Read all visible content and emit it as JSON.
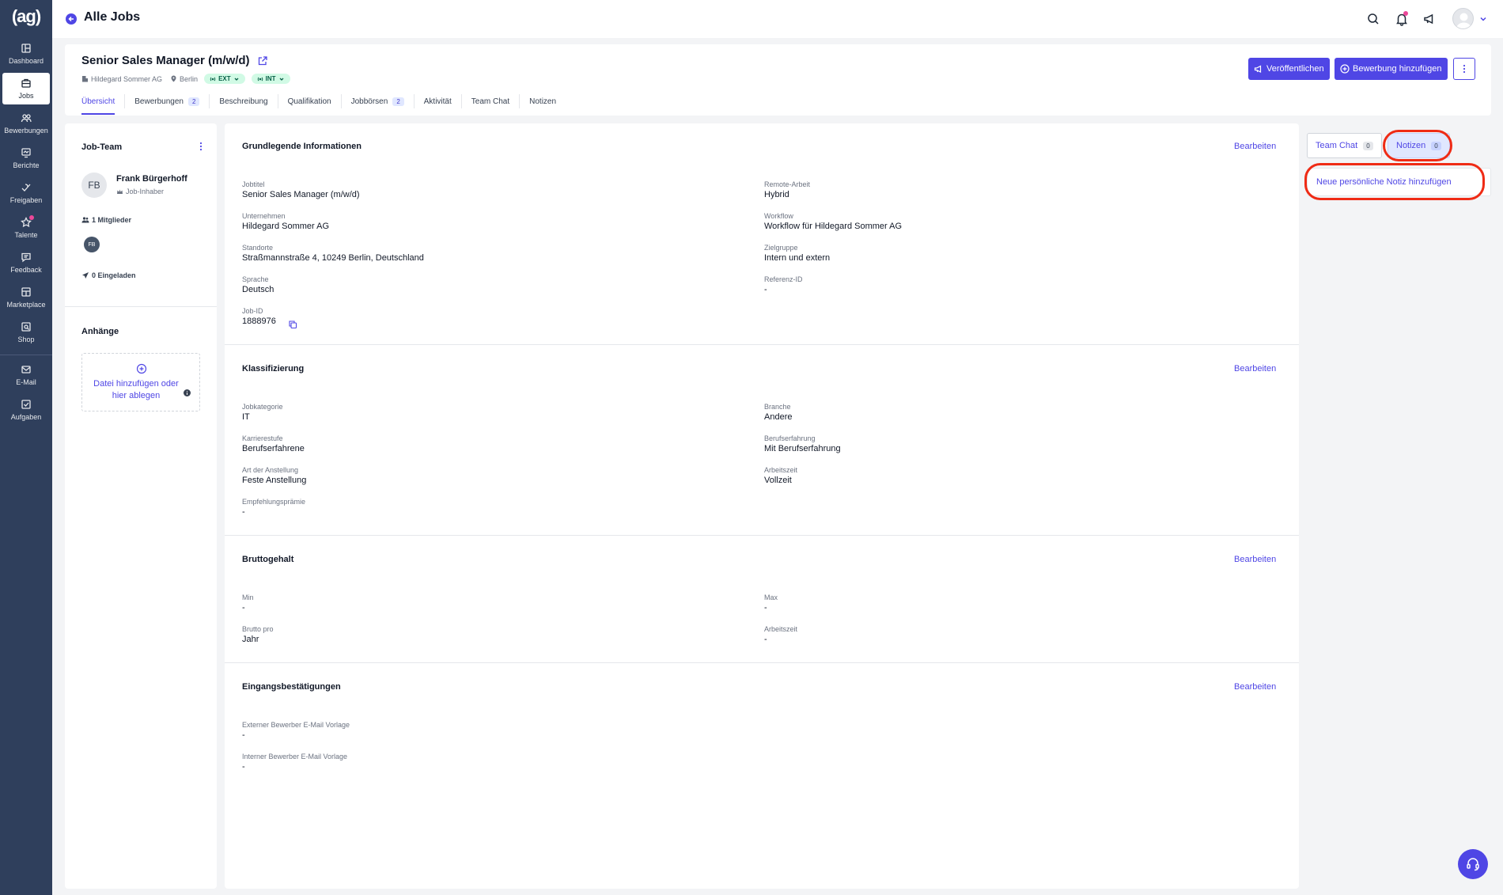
{
  "sidebar": {
    "logo": "(ag)",
    "items": [
      {
        "label": "Dashboard",
        "icon": "dashboard-icon"
      },
      {
        "label": "Jobs",
        "icon": "briefcase-icon",
        "active": true
      },
      {
        "label": "Bewerbungen",
        "icon": "users-icon"
      },
      {
        "label": "Berichte",
        "icon": "chart-icon"
      },
      {
        "label": "Freigaben",
        "icon": "approval-icon"
      },
      {
        "label": "Talente",
        "icon": "star-icon"
      },
      {
        "label": "Feedback",
        "icon": "chat-icon"
      },
      {
        "label": "Marketplace",
        "icon": "grid-icon"
      },
      {
        "label": "Shop",
        "icon": "shop-icon"
      },
      {
        "label": "E-Mail",
        "icon": "mail-icon"
      },
      {
        "label": "Aufgaben",
        "icon": "task-icon"
      }
    ]
  },
  "topbar": {
    "title": "Alle Jobs"
  },
  "job": {
    "title": "Senior Sales Manager (m/w/d)",
    "company": "Hildegard Sommer AG",
    "city": "Berlin",
    "pill_ext": "EXT",
    "pill_int": "INT",
    "publish_label": "Veröffentlichen",
    "add_application_label": "Bewerbung hinzufügen",
    "tabs": [
      {
        "label": "Übersicht",
        "active": true
      },
      {
        "label": "Bewerbungen",
        "badge": "2"
      },
      {
        "label": "Beschreibung"
      },
      {
        "label": "Qualifikation"
      },
      {
        "label": "Jobbörsen",
        "badge": "2"
      },
      {
        "label": "Aktivität"
      },
      {
        "label": "Team Chat"
      },
      {
        "label": "Notizen"
      }
    ]
  },
  "team": {
    "title": "Job-Team",
    "member_initials": "FB",
    "member_name": "Frank Bürgerhoff",
    "member_role": "Job-Inhaber",
    "members_count": "1 Mitglieder",
    "invited": "0 Eingeladen"
  },
  "attachments": {
    "title": "Anhänge",
    "drop_line1": "Datei hinzufügen oder",
    "drop_line2": "hier ablegen"
  },
  "edit_label": "Bearbeiten",
  "sections": {
    "basic": {
      "title": "Grundlegende Informationen",
      "fields": [
        {
          "label": "Jobtitel",
          "value": "Senior Sales Manager (m/w/d)"
        },
        {
          "label": "Remote-Arbeit",
          "value": "Hybrid"
        },
        {
          "label": "Unternehmen",
          "value": "Hildegard Sommer AG"
        },
        {
          "label": "Workflow",
          "value": "Workflow für Hildegard Sommer AG"
        },
        {
          "label": "Standorte",
          "value": "Straßmannstraße 4, 10249 Berlin, Deutschland"
        },
        {
          "label": "Zielgruppe",
          "value": "Intern und extern"
        },
        {
          "label": "Sprache",
          "value": "Deutsch"
        },
        {
          "label": "Referenz-ID",
          "value": "-"
        },
        {
          "label": "Job-ID",
          "value": "1888976"
        }
      ]
    },
    "classification": {
      "title": "Klassifizierung",
      "fields": [
        {
          "label": "Jobkategorie",
          "value": "IT"
        },
        {
          "label": "Branche",
          "value": "Andere"
        },
        {
          "label": "Karrierestufe",
          "value": "Berufserfahrene"
        },
        {
          "label": "Berufserfahrung",
          "value": "Mit Berufserfahrung"
        },
        {
          "label": "Art der Anstellung",
          "value": "Feste Anstellung"
        },
        {
          "label": "Arbeitszeit",
          "value": "Vollzeit"
        },
        {
          "label": "Empfehlungsprämie",
          "value": "-"
        }
      ]
    },
    "salary": {
      "title": "Bruttogehalt",
      "fields": [
        {
          "label": "Min",
          "value": "-"
        },
        {
          "label": "Max",
          "value": "-"
        },
        {
          "label": "Brutto pro",
          "value": "Jahr"
        },
        {
          "label": "Arbeitszeit",
          "value": "-"
        }
      ]
    },
    "confirmations": {
      "title": "Eingangsbestätigungen",
      "fields": [
        {
          "label": "Externer Bewerber E-Mail Vorlage",
          "value": "-"
        },
        {
          "label": "Interner Bewerber E-Mail Vorlage",
          "value": "-"
        }
      ]
    }
  },
  "right": {
    "team_chat_label": "Team Chat",
    "team_chat_count": "0",
    "notes_label": "Notizen",
    "notes_count": "0",
    "new_note_label": "Neue persönliche Notiz hinzufügen"
  },
  "colors": {
    "primary": "#4f46e5",
    "sidebar": "#2f3f5c",
    "highlight": "#ef2b15",
    "pill_bg": "#d1fae5"
  }
}
